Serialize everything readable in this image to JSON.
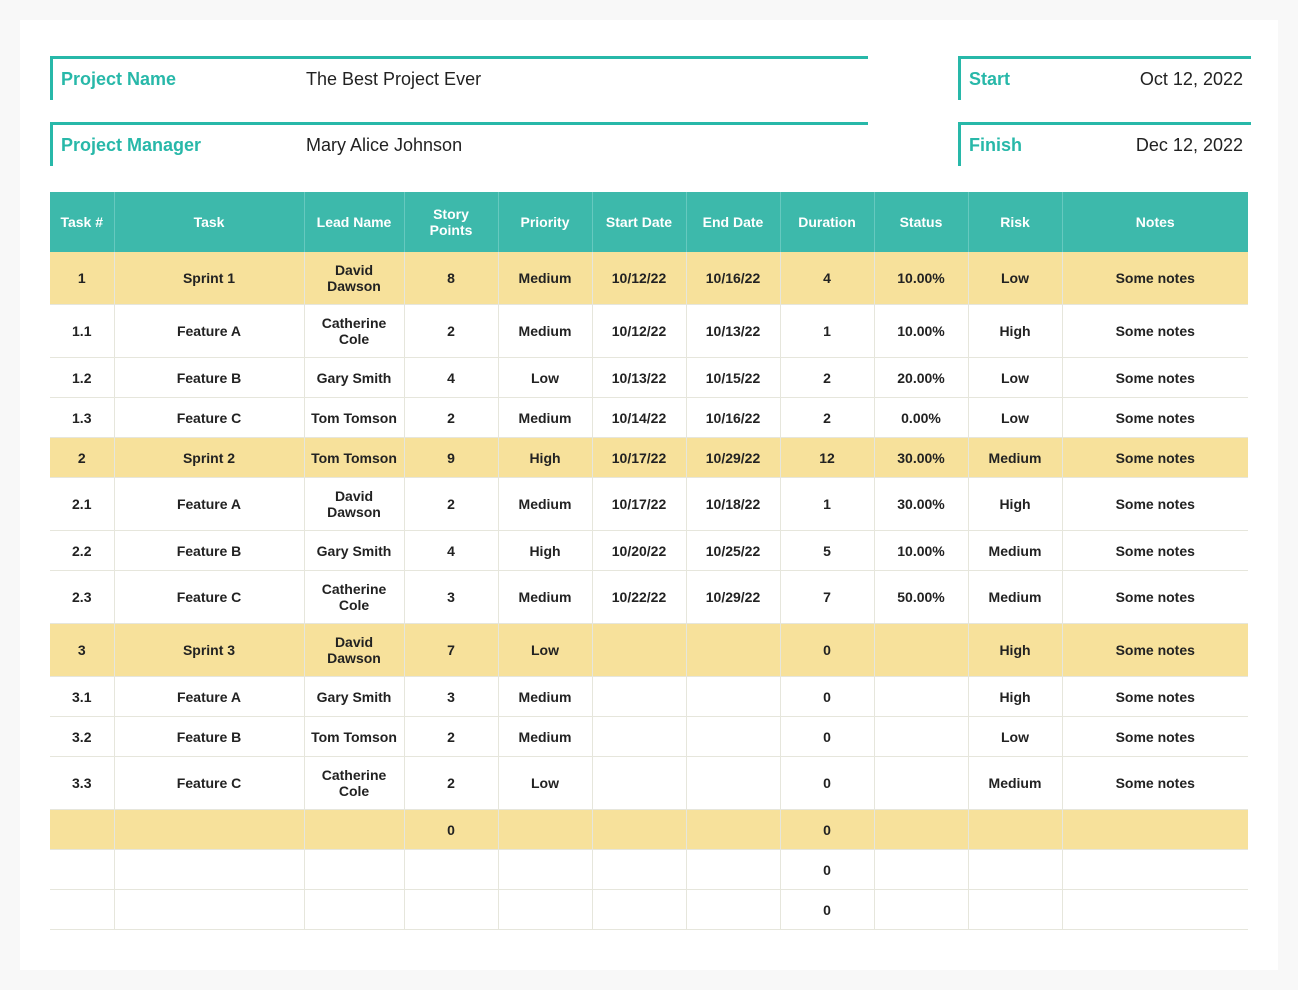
{
  "meta": {
    "project_name_label": "Project Name",
    "project_name_value": "The Best Project Ever",
    "project_manager_label": "Project Manager",
    "project_manager_value": "Mary Alice Johnson",
    "start_label": "Start",
    "start_value": "Oct 12, 2022",
    "finish_label": "Finish",
    "finish_value": "Dec 12, 2022"
  },
  "columns": {
    "tasknum": "Task #",
    "task": "Task",
    "lead": "Lead Name",
    "points": "Story Points",
    "priority": "Priority",
    "start": "Start Date",
    "end": "End Date",
    "duration": "Duration",
    "status": "Status",
    "risk": "Risk",
    "notes": "Notes"
  },
  "rows": [
    {
      "type": "sprint",
      "num": "1",
      "task": "Sprint 1",
      "lead": "David Dawson",
      "points": "8",
      "priority": "Medium",
      "start": "10/12/22",
      "end": "10/16/22",
      "duration": "4",
      "status": "10.00%",
      "risk": "Low",
      "notes": "Some notes"
    },
    {
      "type": "item",
      "num": "1.1",
      "task": "Feature A",
      "lead": "Catherine Cole",
      "points": "2",
      "priority": "Medium",
      "start": "10/12/22",
      "end": "10/13/22",
      "duration": "1",
      "status": "10.00%",
      "risk": "High",
      "notes": "Some notes"
    },
    {
      "type": "item",
      "num": "1.2",
      "task": "Feature B",
      "lead": "Gary Smith",
      "points": "4",
      "priority": "Low",
      "start": "10/13/22",
      "end": "10/15/22",
      "duration": "2",
      "status": "20.00%",
      "risk": "Low",
      "notes": "Some notes"
    },
    {
      "type": "item",
      "num": "1.3",
      "task": "Feature C",
      "lead": "Tom Tomson",
      "points": "2",
      "priority": "Medium",
      "start": "10/14/22",
      "end": "10/16/22",
      "duration": "2",
      "status": "0.00%",
      "risk": "Low",
      "notes": "Some notes"
    },
    {
      "type": "sprint",
      "num": "2",
      "task": "Sprint 2",
      "lead": "Tom Tomson",
      "points": "9",
      "priority": "High",
      "start": "10/17/22",
      "end": "10/29/22",
      "duration": "12",
      "status": "30.00%",
      "risk": "Medium",
      "notes": "Some notes"
    },
    {
      "type": "item",
      "num": "2.1",
      "task": "Feature A",
      "lead": "David Dawson",
      "points": "2",
      "priority": "Medium",
      "start": "10/17/22",
      "end": "10/18/22",
      "duration": "1",
      "status": "30.00%",
      "risk": "High",
      "notes": "Some notes"
    },
    {
      "type": "item",
      "num": "2.2",
      "task": "Feature B",
      "lead": "Gary Smith",
      "points": "4",
      "priority": "High",
      "start": "10/20/22",
      "end": "10/25/22",
      "duration": "5",
      "status": "10.00%",
      "risk": "Medium",
      "notes": "Some notes"
    },
    {
      "type": "item",
      "num": "2.3",
      "task": "Feature C",
      "lead": "Catherine Cole",
      "points": "3",
      "priority": "Medium",
      "start": "10/22/22",
      "end": "10/29/22",
      "duration": "7",
      "status": "50.00%",
      "risk": "Medium",
      "notes": "Some notes"
    },
    {
      "type": "sprint",
      "num": "3",
      "task": "Sprint 3",
      "lead": "David Dawson",
      "points": "7",
      "priority": "Low",
      "start": "",
      "end": "",
      "duration": "0",
      "status": "",
      "risk": "High",
      "notes": "Some notes"
    },
    {
      "type": "item",
      "num": "3.1",
      "task": "Feature A",
      "lead": "Gary Smith",
      "points": "3",
      "priority": "Medium",
      "start": "",
      "end": "",
      "duration": "0",
      "status": "",
      "risk": "High",
      "notes": "Some notes"
    },
    {
      "type": "item",
      "num": "3.2",
      "task": "Feature B",
      "lead": "Tom Tomson",
      "points": "2",
      "priority": "Medium",
      "start": "",
      "end": "",
      "duration": "0",
      "status": "",
      "risk": "Low",
      "notes": "Some notes"
    },
    {
      "type": "item",
      "num": "3.3",
      "task": "Feature C",
      "lead": "Catherine Cole",
      "points": "2",
      "priority": "Low",
      "start": "",
      "end": "",
      "duration": "0",
      "status": "",
      "risk": "Medium",
      "notes": "Some notes"
    },
    {
      "type": "empty-yellow",
      "num": "",
      "task": "",
      "lead": "",
      "points": "0",
      "priority": "",
      "start": "",
      "end": "",
      "duration": "0",
      "status": "",
      "risk": "",
      "notes": ""
    },
    {
      "type": "empty",
      "num": "",
      "task": "",
      "lead": "",
      "points": "",
      "priority": "",
      "start": "",
      "end": "",
      "duration": "0",
      "status": "",
      "risk": "",
      "notes": ""
    },
    {
      "type": "empty",
      "num": "",
      "task": "",
      "lead": "",
      "points": "",
      "priority": "",
      "start": "",
      "end": "",
      "duration": "0",
      "status": "",
      "risk": "",
      "notes": ""
    }
  ]
}
